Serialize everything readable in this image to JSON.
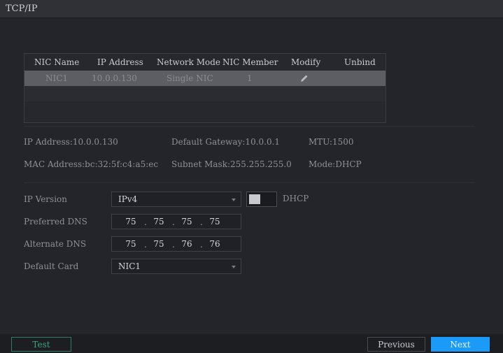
{
  "window": {
    "title": "TCP/IP"
  },
  "nic_table": {
    "headers": {
      "name": "NIC Name",
      "ip": "IP Address",
      "mode": "Network Mode",
      "member": "NIC Member",
      "modify": "Modify",
      "unbind": "Unbind"
    },
    "rows": [
      {
        "name": "NIC1",
        "ip": "10.0.0.130",
        "mode": "Single NIC",
        "member": "1"
      }
    ]
  },
  "info": {
    "ip_address": "IP Address:10.0.0.130",
    "default_gateway": "Default Gateway:10.0.0.1",
    "mtu": "MTU:1500",
    "mac_address": "MAC Address:bc:32:5f:c4:a5:ec",
    "subnet_mask": "Subnet Mask:255.255.255.0",
    "mode": "Mode:DHCP"
  },
  "form": {
    "ip_version": {
      "label": "IP Version",
      "value": "IPv4"
    },
    "dhcp": {
      "label": "DHCP",
      "enabled": false
    },
    "preferred_dns": {
      "label": "Preferred DNS",
      "octets": [
        "75",
        "75",
        "75",
        "75"
      ]
    },
    "alternate_dns": {
      "label": "Alternate DNS",
      "octets": [
        "75",
        "75",
        "76",
        "76"
      ]
    },
    "default_card": {
      "label": "Default Card",
      "value": "NIC1"
    }
  },
  "footer": {
    "test_label": "Test",
    "previous_label": "Previous",
    "next_label": "Next"
  },
  "colors": {
    "accent": "#1b9af7",
    "test_green": "#3fa57f",
    "selected_row": "#5c5e63"
  }
}
